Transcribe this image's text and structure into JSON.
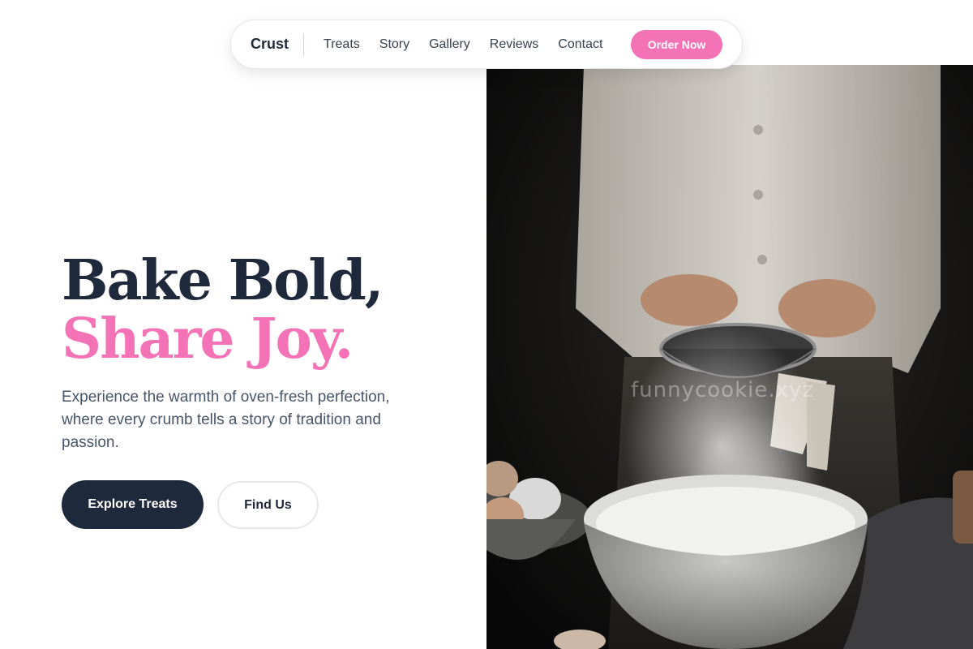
{
  "nav": {
    "brand": "Crust",
    "links": [
      "Treats",
      "Story",
      "Gallery",
      "Reviews",
      "Contact"
    ],
    "order_label": "Order Now"
  },
  "hero": {
    "title_line1": "Bake Bold,",
    "title_line2": "Share Joy.",
    "description": "Experience the warmth of oven-fresh perfection, where every crumb tells a story of tradition and passion.",
    "primary_button": "Explore Treats",
    "secondary_button": "Find Us"
  },
  "photo": {
    "watermark": "funnycookie.xyz"
  },
  "colors": {
    "accent": "#f472b6",
    "dark": "#1e293b",
    "text_muted": "#475569"
  }
}
